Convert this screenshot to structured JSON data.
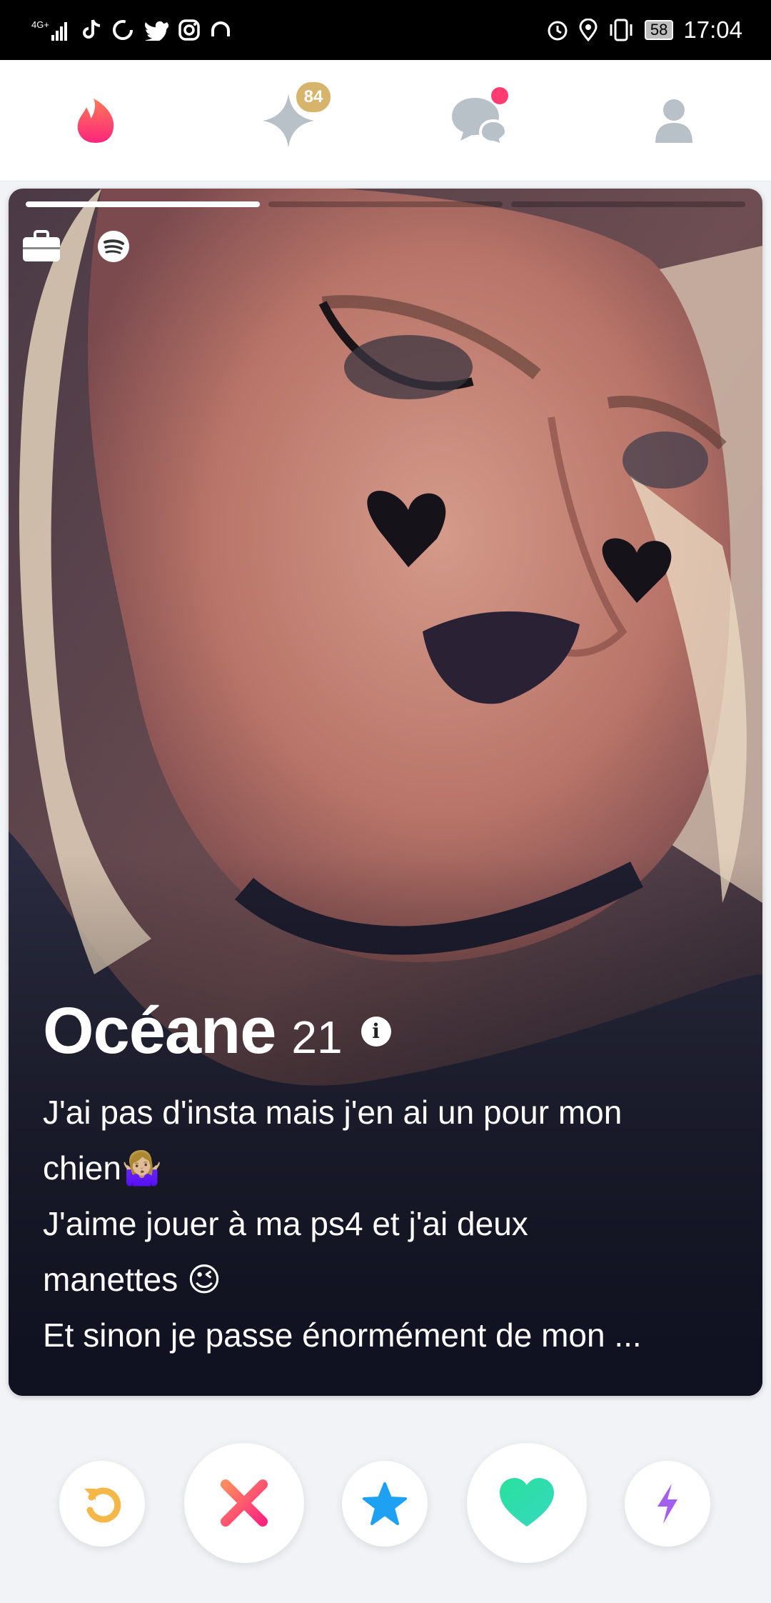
{
  "status_bar": {
    "network": "4G+",
    "battery": "58",
    "time": "17:04"
  },
  "nav": {
    "boost_badge": "84"
  },
  "profile": {
    "name": "Océane",
    "age": "21",
    "info_icon": "i",
    "bio": [
      "J'ai pas d'insta mais j'en ai un pour mon",
      "chien🤷🏼‍♀️",
      "J'aime jouer à ma ps4 et j'ai deux",
      "manettes 😉",
      "Et sinon je passe énormément de mon ..."
    ],
    "photo_count": 3,
    "current_photo": 1
  },
  "colors": {
    "brand": "#fe3c72",
    "rewind": "#f5b748",
    "nope": "#fd5068",
    "super_like": "#1ea1f2",
    "like": "#2fe5a7",
    "boost": "#a25ff0"
  },
  "icons": {
    "nav": [
      "flame-icon",
      "sparkle-icon",
      "chat-bubbles-icon",
      "profile-icon"
    ],
    "card": [
      "briefcase-icon",
      "spotify-icon"
    ],
    "actions": [
      "rewind-icon",
      "nope-icon",
      "star-icon",
      "heart-icon",
      "bolt-icon"
    ]
  }
}
